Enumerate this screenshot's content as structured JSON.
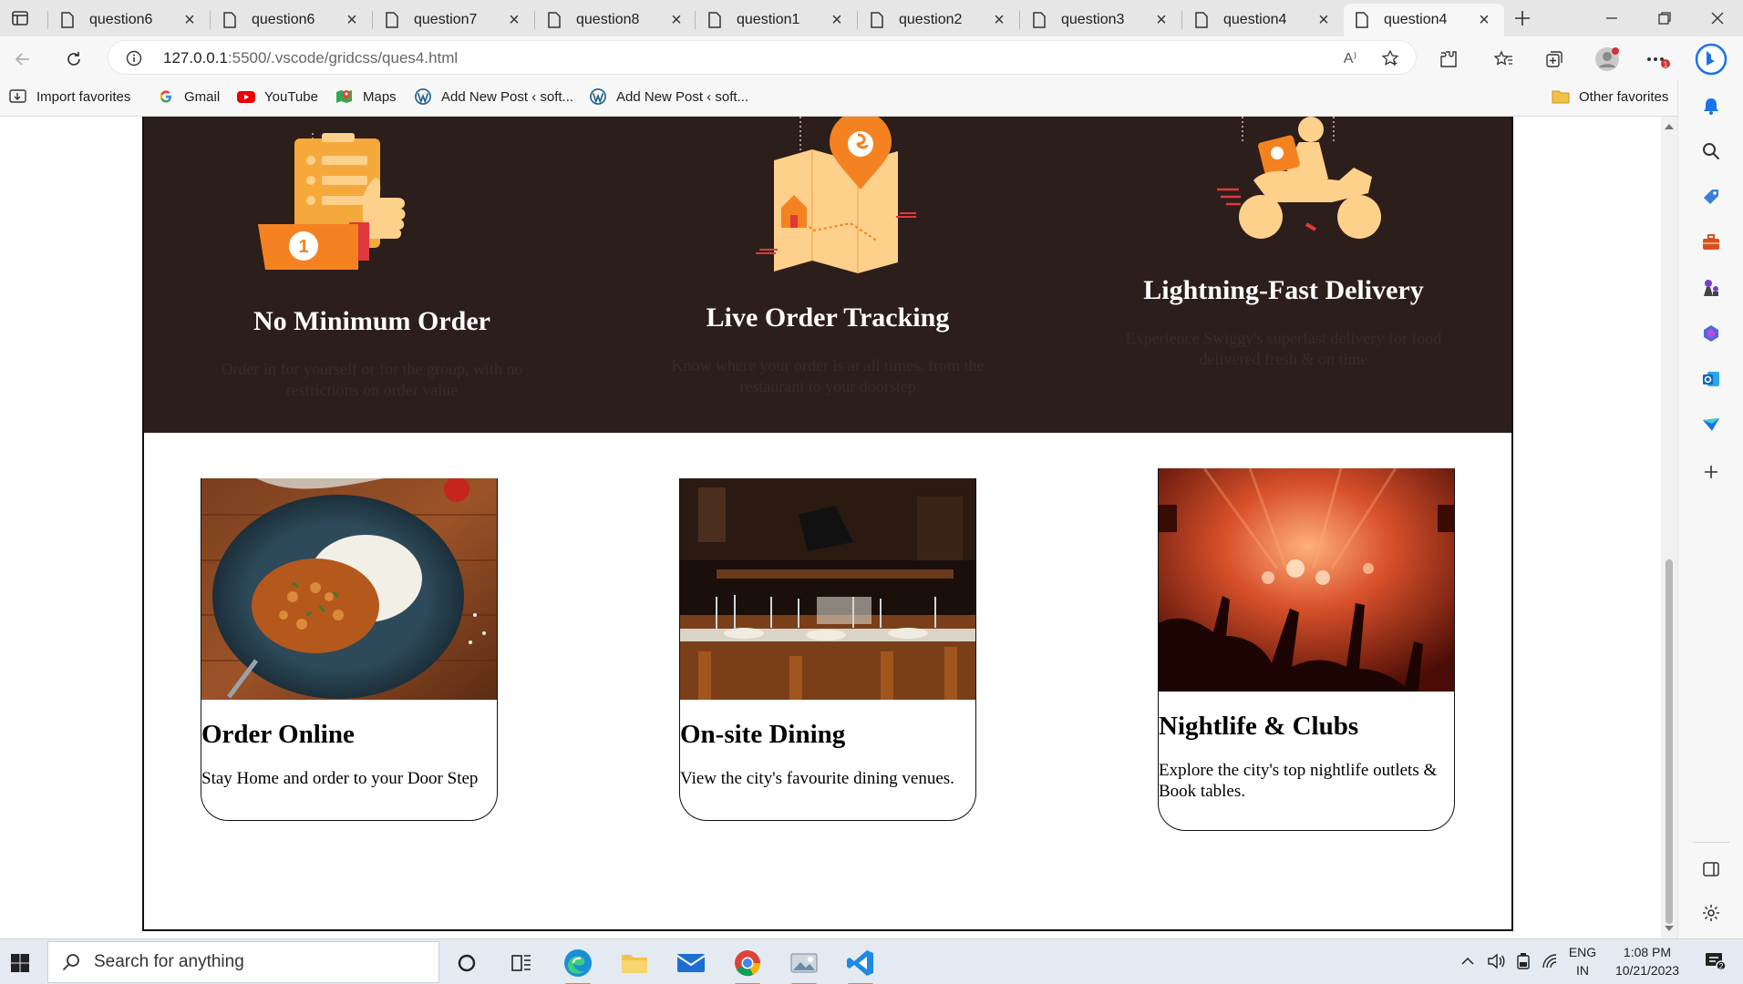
{
  "browser": {
    "tabs": [
      {
        "title": "question6",
        "active": false
      },
      {
        "title": "question6",
        "active": false
      },
      {
        "title": "question7",
        "active": false
      },
      {
        "title": "question8",
        "active": false
      },
      {
        "title": "question1",
        "active": false
      },
      {
        "title": "question2",
        "active": false
      },
      {
        "title": "question3",
        "active": false
      },
      {
        "title": "question4",
        "active": false
      },
      {
        "title": "question4",
        "active": true
      }
    ],
    "address": {
      "host": "127.0.0.1",
      "path": ":5500/.vscode/gridcss/ques4.html"
    },
    "favorites": [
      {
        "label": "Import favorites",
        "icon": "import-favorites-icon"
      },
      {
        "label": "Gmail",
        "icon": "google-icon"
      },
      {
        "label": "YouTube",
        "icon": "youtube-icon"
      },
      {
        "label": "Maps",
        "icon": "maps-icon"
      },
      {
        "label": "Add New Post ‹ soft...",
        "icon": "wordpress-icon"
      },
      {
        "label": "Add New Post ‹ soft...",
        "icon": "wordpress-icon"
      }
    ],
    "other_favorites": "Other favorites",
    "read_aloud_label": "A⁾"
  },
  "page": {
    "features": [
      {
        "title": "No Minimum Order",
        "description": "Order in for yourself or for the group, with no restrictions on order value",
        "icon": "thumbs-up-order-icon"
      },
      {
        "title": "Live Order Tracking",
        "description": "Know where your order is at all times, from the restaurant to your doorstep",
        "icon": "map-tracking-icon"
      },
      {
        "title": "Lightning-Fast Delivery",
        "description": "Experience Swiggy's superfast delivery for food delivered fresh & on time",
        "icon": "delivery-scooter-icon"
      }
    ],
    "cards": [
      {
        "title": "Order Online",
        "description": "Stay Home and order to your Door Step",
        "image": "food-plate-photo"
      },
      {
        "title": "On-site Dining",
        "description": "View the city's favourite dining venues.",
        "image": "restaurant-interior-photo"
      },
      {
        "title": "Nightlife & Clubs",
        "description": "Explore the city's top nightlife outlets & Book tables.",
        "image": "nightclub-crowd-photo"
      }
    ],
    "colors": {
      "feature_band": "#2c1e1a",
      "feature_title": "#ffffff",
      "feature_text": "#3b2b25",
      "accent_orange": "#f58220",
      "accent_peach": "#fdd08c"
    }
  },
  "taskbar": {
    "search_placeholder": "Search for anything",
    "language": "ENG",
    "region": "IN",
    "time": "1:08 PM",
    "date": "10/21/2023"
  }
}
